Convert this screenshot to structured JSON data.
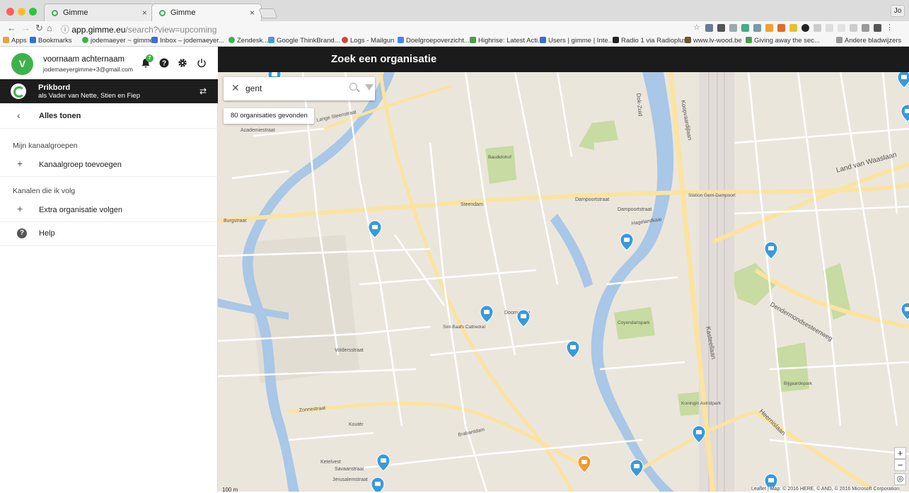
{
  "browser": {
    "tabs": [
      {
        "label": "Gimme"
      },
      {
        "label": "Gimme"
      }
    ],
    "profile_label": "Jo",
    "url_host": "app.gimme.eu",
    "url_path": "/search?view=upcoming",
    "bookmarks": [
      {
        "label": "Apps",
        "color": "#e8a33b"
      },
      {
        "label": "Bookmarks",
        "color": "#2e74d0"
      },
      {
        "label": "jodemaeyer ~ gimme",
        "color": "#3eb24a"
      },
      {
        "label": "Inbox – jodemaeyer...",
        "color": "#3b6ed8"
      },
      {
        "label": "Zendesk...",
        "color": "#3eb24a"
      },
      {
        "label": "Google ThinkBrand...",
        "color": "#4a9ad8"
      },
      {
        "label": "Logs - Mailgun",
        "color": "#d6453d"
      },
      {
        "label": "Doelgroepoverzicht...",
        "color": "#4285f4"
      },
      {
        "label": "Highrise: Latest Acti...",
        "color": "#4aa04a"
      },
      {
        "label": "Users | gimme | Inte...",
        "color": "#3a6ed0"
      },
      {
        "label": "Radio 1 via Radioplus",
        "color": "#222222"
      },
      {
        "label": "www.lv-wood.be",
        "color": "#6a5a2a"
      },
      {
        "label": "Giving away the sec...",
        "color": "#4aa04a"
      },
      {
        "label": "Andere bladwijzers",
        "color": "#999999"
      }
    ]
  },
  "sidebar": {
    "avatar_letter": "V",
    "user_name": "voornaam achternaam",
    "user_email": "jodemaeyergimme+3@gmail.com",
    "notification_count": "7",
    "prikbord_title": "Prikbord",
    "prikbord_subtitle": "als Vader van Nette, Stien en Fiep",
    "back_label": "Alles tonen",
    "section_groups": "Mijn kanaalgroepen",
    "add_group_label": "Kanaalgroep toevoegen",
    "section_channels": "Kanalen die ik volg",
    "follow_extra_label": "Extra organisatie volgen",
    "help_label": "Help"
  },
  "main": {
    "title": "Zoek een organisatie",
    "search_value": "gent",
    "result_count": "80 organisaties gevonden",
    "zoom_in": "+",
    "zoom_out": "−",
    "scale_label": "100 m",
    "attribution": "Leaflet | Map: © 2016 HERE, © AND, © 2016 Microsoft Corporation"
  },
  "map": {
    "street_labels": [
      "Academiestraat",
      "Lange Steenstraat",
      "Burgstraat",
      "Steendam",
      "Dampoortstraat",
      "Hagelandkaai",
      "Land van Waaslaan",
      "Kasteellaan",
      "Dendermondsesteenweg",
      "Zonnestraat",
      "Koutér",
      "Brabantdam",
      "Voldersstraat",
      "Sint-Jacobsnieuwstraat",
      "Koopvaardijlaan",
      "Dok-Zuid",
      "Heernislaan",
      "Kastanjestraat",
      "Doornsteeg",
      "Kortrijksesteenweg",
      "Savaanstraat",
      "Jerusalemstraat",
      "Kalverstraat",
      "Dampoortstraat",
      "Station Gent-Dampoort",
      "Baudelohof",
      "Citadelpark",
      "Koningin Astridpark",
      "Bijgaardepark",
      "Coyendanspark",
      "Sint-Baafs Cathedral"
    ],
    "marker_color": "#3a9ad9",
    "selected_marker_color": "#f29a2e"
  }
}
